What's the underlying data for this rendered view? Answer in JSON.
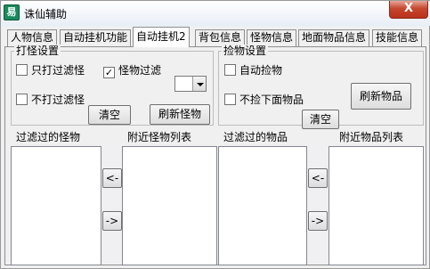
{
  "window": {
    "title": "诛仙辅助",
    "icon_glyph": "易",
    "close_glyph": "X"
  },
  "tabs": [
    {
      "label": "人物信息",
      "active": false
    },
    {
      "label": "自动挂机功能",
      "active": false
    },
    {
      "label": "自动挂机2",
      "active": true
    },
    {
      "label": "背包信息",
      "active": false
    },
    {
      "label": "怪物信息",
      "active": false
    },
    {
      "label": "地面物品信息",
      "active": false
    },
    {
      "label": "技能信息",
      "active": false
    }
  ],
  "monster_group": {
    "title": "打怪设置",
    "only_filtered_label": "只打过滤怪",
    "only_filtered_checked": false,
    "monster_filter_label": "怪物过滤",
    "monster_filter_checked": true,
    "not_filtered_label": "不打过滤怪",
    "not_filtered_checked": false,
    "dropdown_value": "",
    "clear_button": "清空",
    "refresh_button": "刷新怪物",
    "filtered_list_label": "过滤过的怪物",
    "nearby_list_label": "附近怪物列表",
    "move_left_button": "<-",
    "move_right_button": "->"
  },
  "item_group": {
    "title": "捡物设置",
    "auto_pickup_label": "自动捡物",
    "auto_pickup_checked": false,
    "no_pickup_below_label": "不捡下面物品",
    "no_pickup_below_checked": false,
    "clear_button": "清空",
    "refresh_button": "刷新物品",
    "filtered_list_label": "过滤过的物品",
    "nearby_list_label": "附近物品列表",
    "move_left_button": "<-",
    "move_right_button": "->"
  },
  "check_glyph": "✓"
}
